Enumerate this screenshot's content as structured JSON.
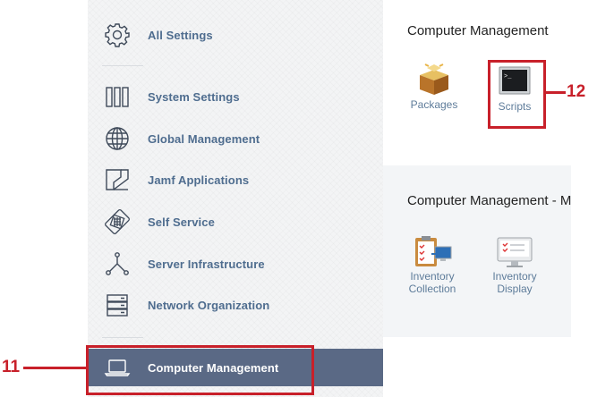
{
  "sidebar": {
    "items": [
      {
        "label": "All Settings",
        "icon": "gear-icon"
      },
      {
        "label": "System Settings",
        "icon": "bar-columns-icon"
      },
      {
        "label": "Global Management",
        "icon": "globe-icon"
      },
      {
        "label": "Jamf Applications",
        "icon": "jamf-apps-icon"
      },
      {
        "label": "Self Service",
        "icon": "self-service-icon"
      },
      {
        "label": "Server Infrastructure",
        "icon": "network-nodes-icon"
      },
      {
        "label": "Network Organization",
        "icon": "server-stack-icon"
      },
      {
        "label": "Computer Management",
        "icon": "laptop-icon",
        "active": true
      }
    ]
  },
  "main": {
    "section1": {
      "title": "Computer Management",
      "tiles": [
        {
          "label": "Packages",
          "icon": "package-box-icon"
        },
        {
          "label": "Scripts",
          "icon": "terminal-icon"
        }
      ]
    },
    "section2": {
      "title": "Computer Management - M",
      "tiles": [
        {
          "line1": "Inventory",
          "line2": "Collection",
          "icon": "inventory-collection-icon"
        },
        {
          "line1": "Inventory",
          "line2": "Display",
          "icon": "inventory-display-icon"
        }
      ]
    }
  },
  "callouts": [
    {
      "number": "11"
    },
    {
      "number": "12"
    }
  ],
  "colors": {
    "sidebar_bg": "#f3f4f5",
    "active_bg": "#5a6985",
    "label_blue": "#4f6d8f",
    "callout_red": "#c8202a"
  }
}
